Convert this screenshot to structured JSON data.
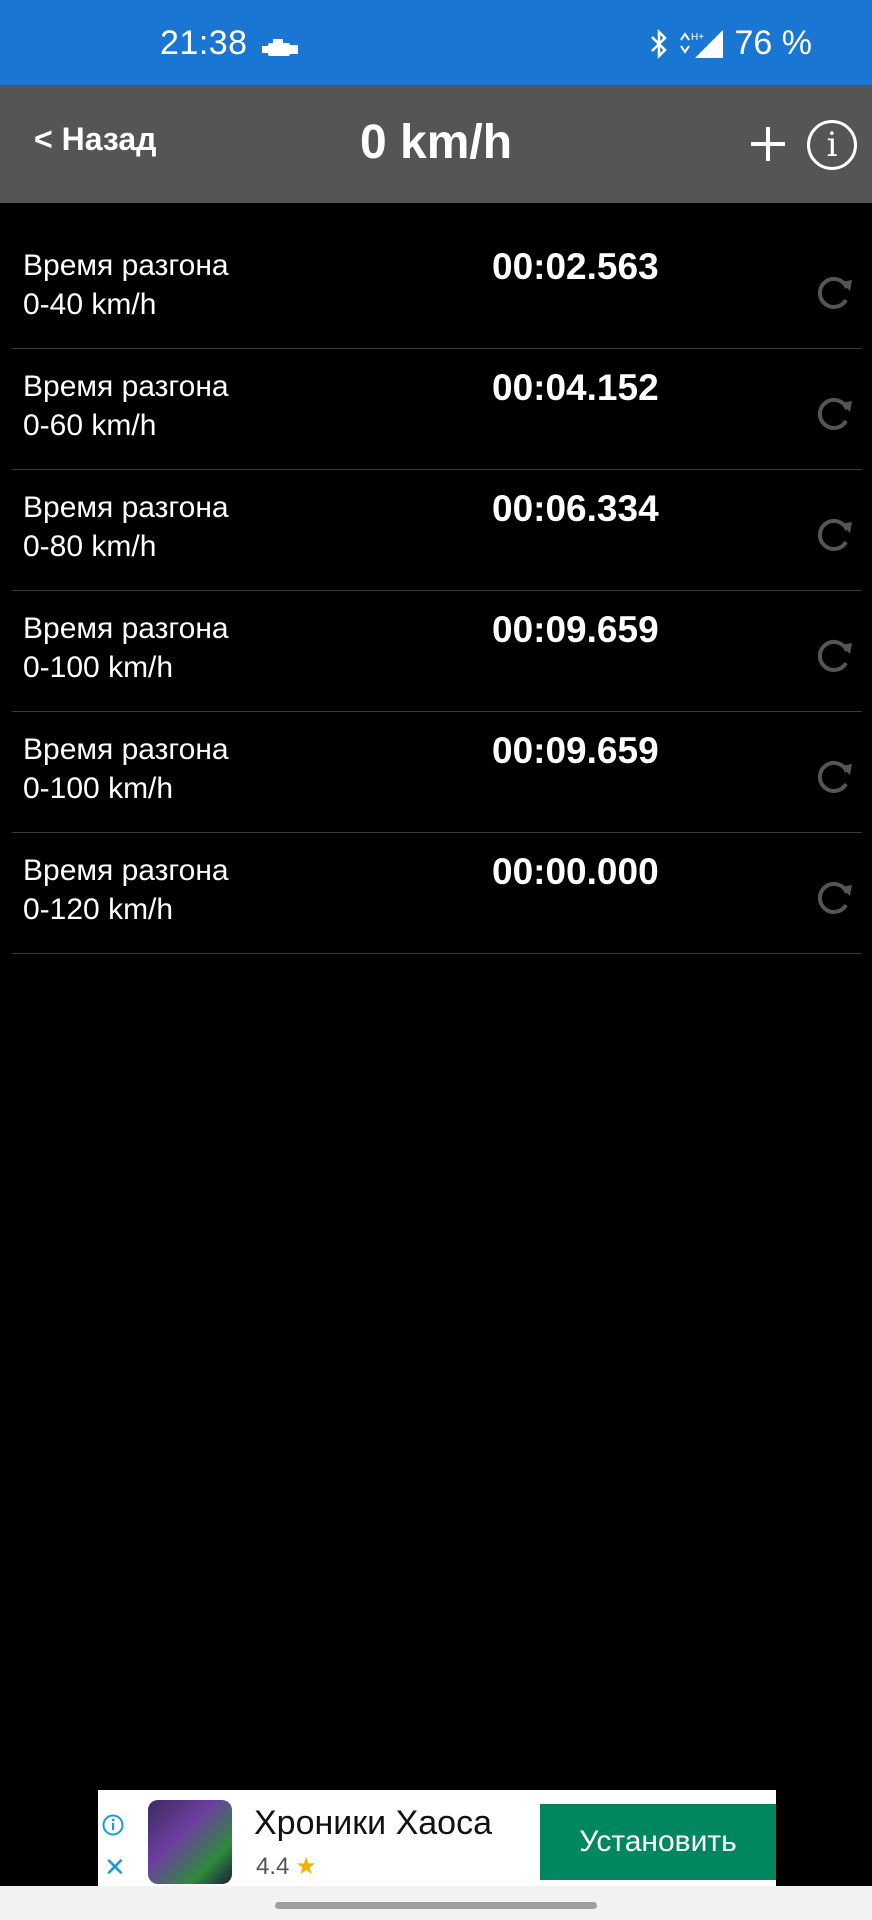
{
  "status_bar": {
    "time": "21:38",
    "battery": "76 %",
    "icons": [
      "car-engine-icon",
      "bluetooth-icon",
      "signal-icon"
    ]
  },
  "toolbar": {
    "back_label": "< Назад",
    "title": "0 km/h",
    "add_icon": "plus-icon",
    "info_icon": "info-icon"
  },
  "rows": [
    {
      "label_line1": "Время разгона",
      "label_line2": "0-40 km/h",
      "time": "00:02.563"
    },
    {
      "label_line1": "Время разгона",
      "label_line2": "0-60 km/h",
      "time": "00:04.152"
    },
    {
      "label_line1": "Время разгона",
      "label_line2": "0-80 km/h",
      "time": "00:06.334"
    },
    {
      "label_line1": "Время разгона",
      "label_line2": "0-100 km/h",
      "time": "00:09.659"
    },
    {
      "label_line1": "Время разгона",
      "label_line2": "0-100 km/h",
      "time": "00:09.659"
    },
    {
      "label_line1": "Время разгона",
      "label_line2": "0-120 km/h",
      "time": "00:00.000"
    }
  ],
  "ad": {
    "title": "Хроники Хаоса",
    "rating": "4.4",
    "install_label": "Установить"
  },
  "colors": {
    "status_bar": "#1976d2",
    "toolbar": "#555555",
    "background": "#000000",
    "install_button": "#01875f"
  }
}
